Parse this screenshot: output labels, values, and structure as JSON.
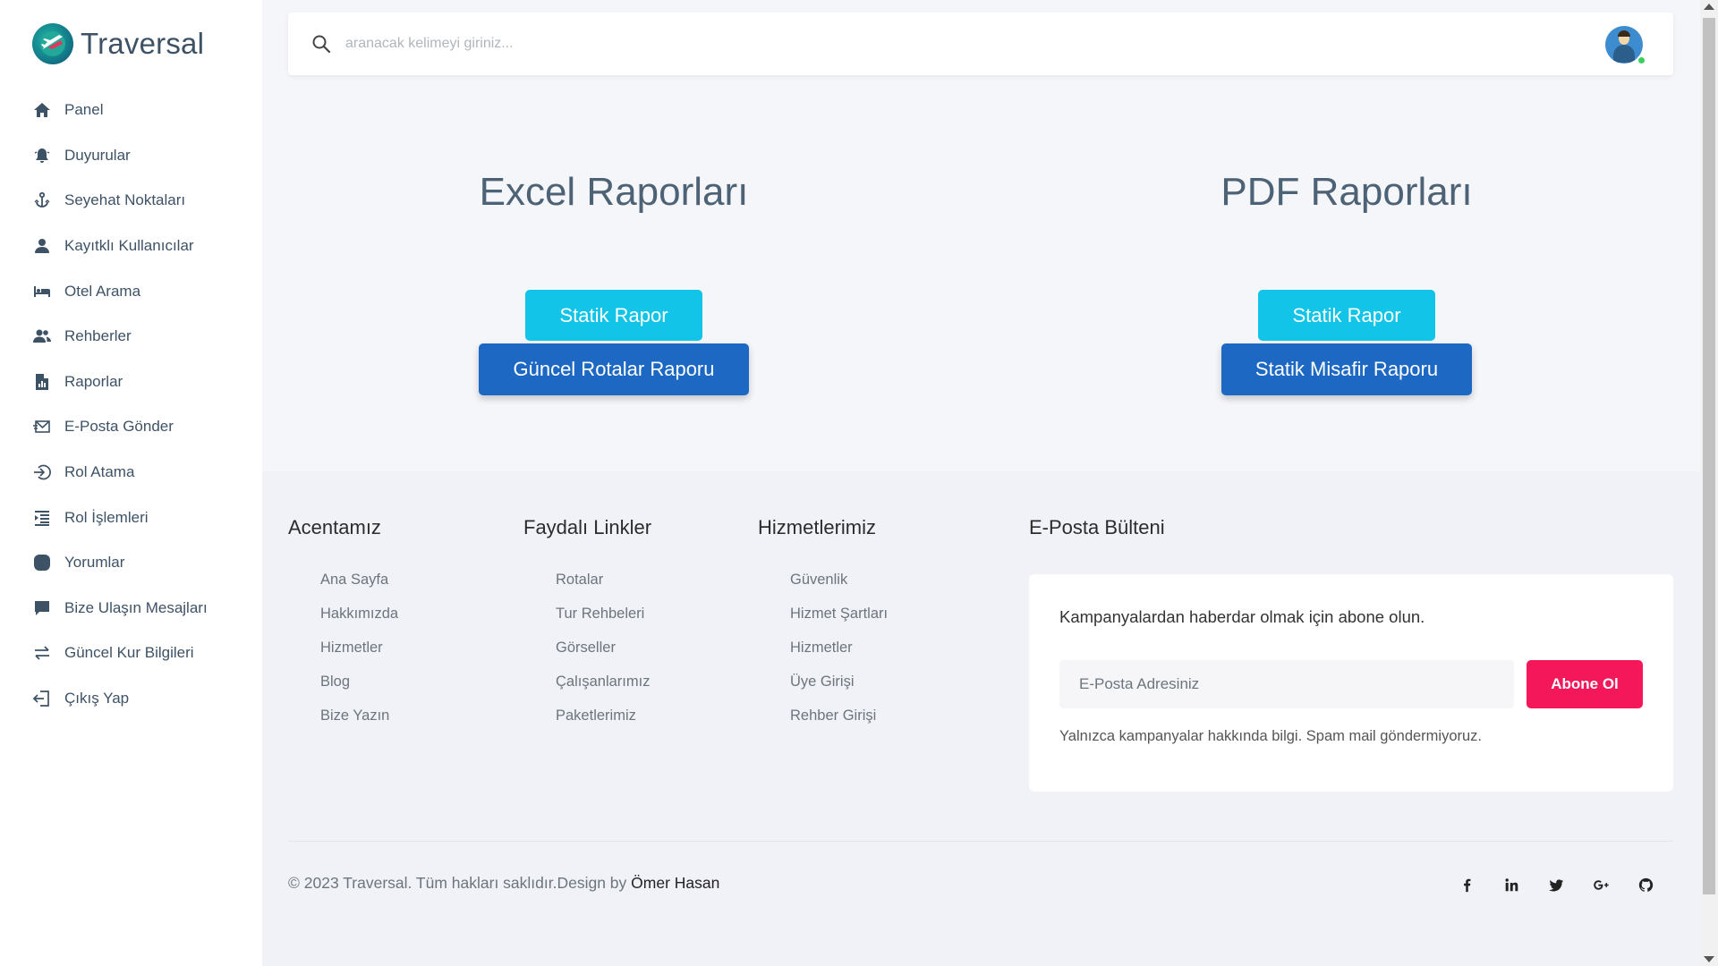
{
  "brand": {
    "name": "Traversal"
  },
  "sidebar": {
    "items": [
      {
        "label": "Panel",
        "icon": "home-icon"
      },
      {
        "label": "Duyurular",
        "icon": "bell-icon"
      },
      {
        "label": "Seyehat Noktaları",
        "icon": "anchor-icon"
      },
      {
        "label": "Kayıtklı Kullanıcılar",
        "icon": "user-icon"
      },
      {
        "label": "Otel Arama",
        "icon": "bed-icon"
      },
      {
        "label": "Rehberler",
        "icon": "users-icon"
      },
      {
        "label": "Raporlar",
        "icon": "report-file-icon"
      },
      {
        "label": "E-Posta Gönder",
        "icon": "mail-send-icon"
      },
      {
        "label": "Rol Atama",
        "icon": "login-arrow-icon"
      },
      {
        "label": "Rol İşlemleri",
        "icon": "list-indent-icon"
      },
      {
        "label": "Yorumlar",
        "icon": "comment-icon"
      },
      {
        "label": "Bize Ulaşın Mesajları",
        "icon": "message-icon"
      },
      {
        "label": "Güncel Kur Bilgileri",
        "icon": "exchange-icon"
      },
      {
        "label": "Çıkış Yap",
        "icon": "logout-icon"
      }
    ]
  },
  "search": {
    "placeholder": "aranacak kelimeyi giriniz..."
  },
  "reports": {
    "excel": {
      "title": "Excel Raporları",
      "static_button": "Statik Rapor",
      "second_button": "Güncel Rotalar Raporu"
    },
    "pdf": {
      "title": "PDF Raporları",
      "static_button": "Statik Rapor",
      "second_button": "Statik Misafir Raporu"
    }
  },
  "footer": {
    "columns": [
      {
        "title": "Acentamız",
        "links": [
          "Ana Sayfa",
          "Hakkımızda",
          "Hizmetler",
          "Blog",
          "Bize Yazın"
        ]
      },
      {
        "title": "Faydalı Linkler",
        "links": [
          "Rotalar",
          "Tur Rehbeleri",
          "Görseller",
          "Çalışanlarımız",
          "Paketlerimiz"
        ]
      },
      {
        "title": "Hizmetlerimiz",
        "links": [
          "Güvenlik",
          "Hizmet Şartları",
          "Hizmetler",
          "Üye Girişi",
          "Rehber Girişi"
        ]
      }
    ],
    "newsletter": {
      "title": "E-Posta Bülteni",
      "text": "Kampanyalardan haberdar olmak için abone olun.",
      "placeholder": "E-Posta Adresiniz",
      "button": "Abone Ol",
      "note": "Yalnızca kampanyalar hakkında bilgi. Spam mail göndermiyoruz."
    },
    "copyright": "© 2023 Traversal. Tüm hakları saklıdır.Design by ",
    "author": "Ömer Hasan",
    "socials": [
      "facebook-icon",
      "linkedin-icon",
      "twitter-icon",
      "google-plus-icon",
      "github-icon"
    ]
  },
  "colors": {
    "accent_cyan": "#12c4e7",
    "accent_blue": "#1d68c2",
    "subscribe_pink": "#f4175a",
    "sidebar_text": "#3e5266"
  }
}
